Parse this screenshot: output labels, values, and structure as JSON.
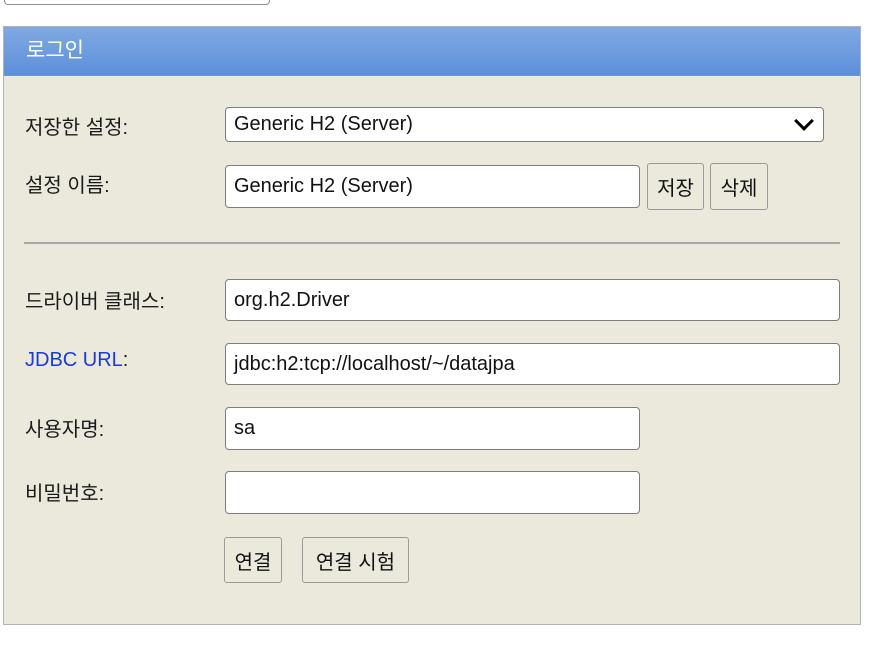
{
  "header": {
    "title": "로그인"
  },
  "saved_settings": {
    "label": "저장한 설정:",
    "selected": "Generic H2 (Server)"
  },
  "setting_name": {
    "label": "설정 이름:",
    "value": "Generic H2 (Server)",
    "save_label": "저장",
    "delete_label": "삭제"
  },
  "driver_class": {
    "label": "드라이버 클래스:",
    "value": "org.h2.Driver"
  },
  "jdbc_url": {
    "label_link": "JDBC URL",
    "label_suffix": ":",
    "value": "jdbc:h2:tcp://localhost/~/datajpa"
  },
  "username": {
    "label": "사용자명:",
    "value": "sa"
  },
  "password": {
    "label": "비밀번호:",
    "value": ""
  },
  "actions": {
    "connect_label": "연결",
    "test_label": "연결 시험"
  },
  "colors": {
    "header_bg": "#6a99de",
    "panel_bg": "#ebe8dc",
    "link": "#1a3bd6"
  }
}
